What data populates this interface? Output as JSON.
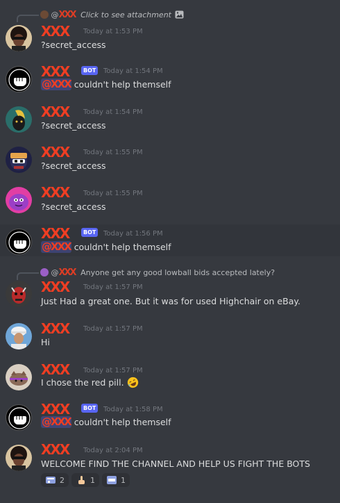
{
  "messages": [
    {
      "reply": {
        "prefix": "@",
        "name": "XXX",
        "text": "Click to see attachment",
        "italic": true
      },
      "author": "XXX",
      "bot": false,
      "time": "Today at 1:53 PM",
      "text": "?secret_access",
      "avatar": "avatar-afro-icon"
    },
    {
      "author": "XXX",
      "bot": true,
      "bot_label": "BOT",
      "time": "Today at 1:54 PM",
      "mention": "@XXX",
      "text": "couldn't help themself",
      "avatar": "fist-bot-icon"
    },
    {
      "author": "XXX",
      "bot": false,
      "time": "Today at 1:54 PM",
      "text": "?secret_access",
      "avatar": "avatar-blonde-icon"
    },
    {
      "author": "XXX",
      "bot": false,
      "time": "Today at 1:55 PM",
      "text": "?secret_access",
      "avatar": "avatar-wtf-icon"
    },
    {
      "author": "XXX",
      "bot": false,
      "time": "Today at 1:55 PM",
      "text": "?secret_access",
      "avatar": "avatar-pink-blob-icon"
    },
    {
      "author": "XXX",
      "bot": true,
      "bot_label": "BOT",
      "time": "Today at 1:56 PM",
      "mention": "@XXX",
      "text": "couldn't help themself",
      "avatar": "fist-bot-icon"
    },
    {
      "reply": {
        "prefix": "@",
        "name": "XXX",
        "text": "Anyone get any good lowball bids accepted lately?",
        "italic": false
      },
      "author": "XXX",
      "bot": false,
      "time": "Today at 1:57 PM",
      "text": "Just Had a great one.  But it was for used Highchair on eBay.",
      "avatar": "avatar-red-demon-icon"
    },
    {
      "author": "XXX",
      "bot": false,
      "time": "Today at 1:57 PM",
      "text": "Hi",
      "avatar": "avatar-white-cap-icon"
    },
    {
      "author": "XXX",
      "bot": false,
      "time": "Today at 1:57 PM",
      "text": "I chose the red pill.",
      "emoji": "rofl-emoji-icon",
      "avatar": "avatar-cat-icon"
    },
    {
      "author": "XXX",
      "bot": true,
      "bot_label": "BOT",
      "time": "Today at 1:58 PM",
      "mention": "@XXX",
      "text": "couldn't help themself",
      "avatar": "fist-bot-icon"
    },
    {
      "author": "XXX",
      "bot": false,
      "time": "Today at 2:04 PM",
      "text": "WELCOME FIND THE CHANNEL AND HELP US FIGHT THE BOTS",
      "avatar": "avatar-afro-icon",
      "reactions": [
        {
          "icon": "reaction-bot-hand-icon",
          "count": "2"
        },
        {
          "icon": "reaction-middle-finger-icon",
          "count": "1"
        },
        {
          "icon": "reaction-this-icon",
          "count": "1"
        }
      ]
    }
  ],
  "colors": {
    "background": "#36393f",
    "redacted_name": "#ef3e23",
    "bot_tag": "#5865f2",
    "mention_bg": "rgba(88,101,242,0.3)",
    "timestamp": "#72767d"
  }
}
